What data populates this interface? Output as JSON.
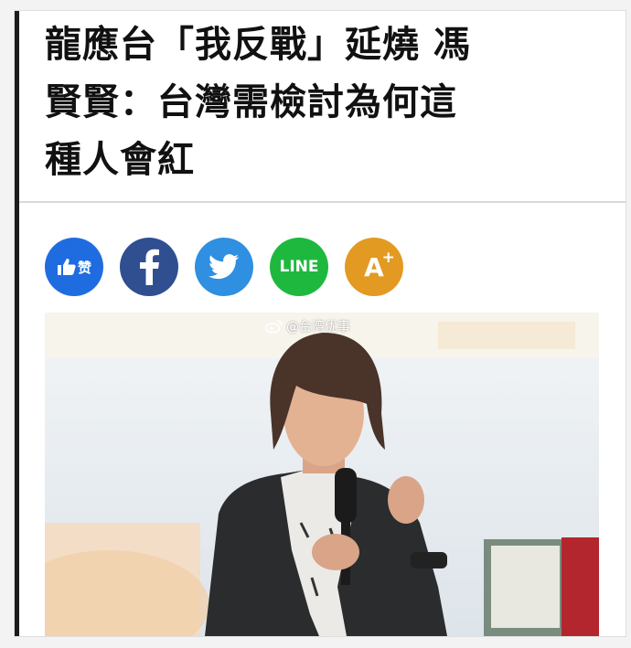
{
  "article": {
    "headline_lines": [
      "龍應台「我反戰」延燒 馮",
      "賢賢：台灣需檢討為何這",
      "種人會紅"
    ]
  },
  "share": {
    "like_label": "赞",
    "facebook_label": "f",
    "line_label": "LINE",
    "font_label": "A",
    "font_plus": "+"
  },
  "photo": {
    "watermark": "@台湾优事"
  },
  "colors": {
    "like": "#1f6ce0",
    "facebook": "#2f4f91",
    "twitter": "#2f8fe0",
    "line": "#1fb83f",
    "font_size": "#e29a22"
  }
}
